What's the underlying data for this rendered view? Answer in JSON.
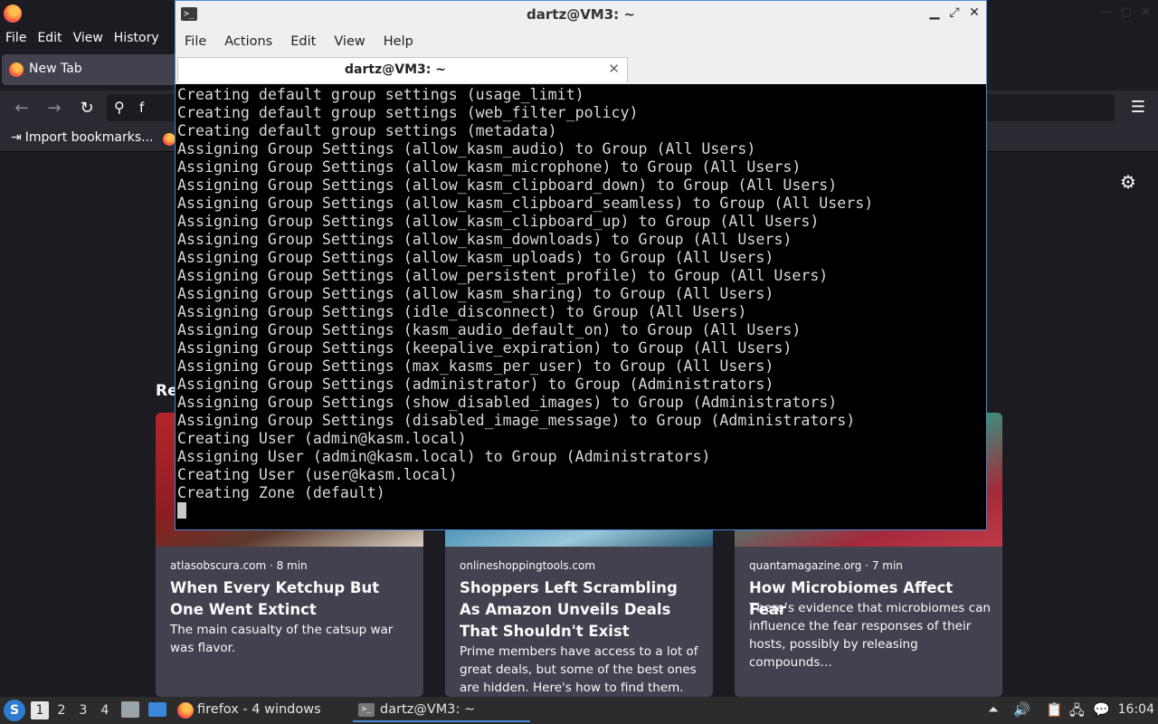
{
  "firefox": {
    "menu": [
      "File",
      "Edit",
      "View",
      "History"
    ],
    "tab_label": "New Tab",
    "url_text": "f",
    "bookmark_import": "Import bookmarks...",
    "recent_heading": "Re",
    "cards": [
      {
        "source": "atlasobscura.com · 8 min",
        "title": "When Every Ketchup But One Went Extinct",
        "description": "The main casualty of the catsup war was flavor."
      },
      {
        "source": "onlineshoppingtools.com",
        "title": "Shoppers Left Scrambling As Amazon Unveils Deals That Shouldn't Exist",
        "description": "Prime members have access to a lot of great deals, but some of the best ones are hidden. Here's how to find them."
      },
      {
        "source": "quantamagazine.org · 7 min",
        "title": "How Microbiomes Affect Fear",
        "description": "There’s evidence that microbiomes can influence the fear responses of their hosts, possibly by releasing compounds…"
      }
    ]
  },
  "terminal": {
    "window_title": "dartz@VM3: ~",
    "menu": [
      "File",
      "Actions",
      "Edit",
      "View",
      "Help"
    ],
    "tab_label": "dartz@VM3: ~",
    "lines": [
      "Creating default group settings (usage_limit)",
      "Creating default group settings (web_filter_policy)",
      "Creating default group settings (metadata)",
      "Assigning Group Settings (allow_kasm_audio) to Group (All Users)",
      "Assigning Group Settings (allow_kasm_microphone) to Group (All Users)",
      "Assigning Group Settings (allow_kasm_clipboard_down) to Group (All Users)",
      "Assigning Group Settings (allow_kasm_clipboard_seamless) to Group (All Users)",
      "Assigning Group Settings (allow_kasm_clipboard_up) to Group (All Users)",
      "Assigning Group Settings (allow_kasm_downloads) to Group (All Users)",
      "Assigning Group Settings (allow_kasm_uploads) to Group (All Users)",
      "Assigning Group Settings (allow_persistent_profile) to Group (All Users)",
      "Assigning Group Settings (allow_kasm_sharing) to Group (All Users)",
      "Assigning Group Settings (idle_disconnect) to Group (All Users)",
      "Assigning Group Settings (kasm_audio_default_on) to Group (All Users)",
      "Assigning Group Settings (keepalive_expiration) to Group (All Users)",
      "Assigning Group Settings (max_kasms_per_user) to Group (All Users)",
      "Assigning Group Settings (administrator) to Group (Administrators)",
      "Assigning Group Settings (show_disabled_images) to Group (Administrators)",
      "Assigning Group Settings (disabled_image_message) to Group (Administrators)",
      "Creating User (admin@kasm.local)",
      "Assigning User (admin@kasm.local) to Group (Administrators)",
      "Creating User (user@kasm.local)",
      "Creating Zone (default)"
    ]
  },
  "taskbar": {
    "workspaces": [
      "1",
      "2",
      "3",
      "4"
    ],
    "active_workspace": "1",
    "firefox_label": "firefox - 4 windows",
    "terminal_label": "dartz@VM3: ~",
    "clock": "16:04"
  },
  "colors": {
    "terminal_bg": "#000000",
    "terminal_fg": "#d8d8d8",
    "firefox_bg": "#1c1b22",
    "card_bg": "#42414d",
    "accent": "#4a8ad4"
  }
}
